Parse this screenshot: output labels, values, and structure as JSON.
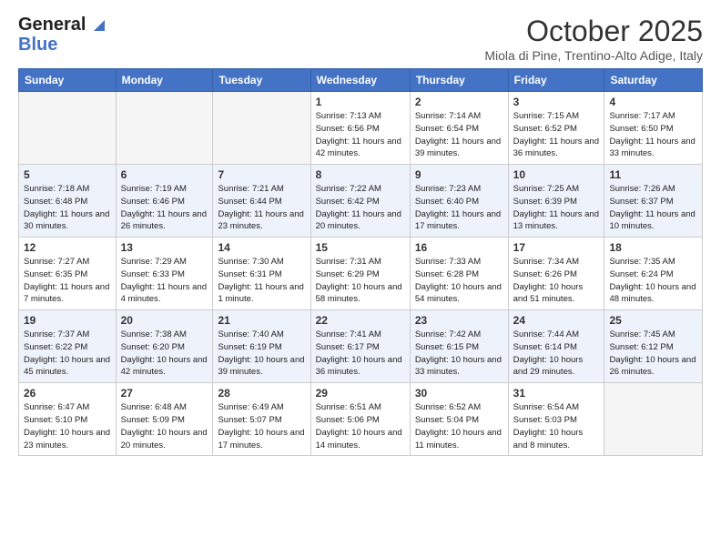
{
  "logo": {
    "line1": "General",
    "line2": "Blue"
  },
  "header": {
    "month": "October 2025",
    "location": "Miola di Pine, Trentino-Alto Adige, Italy"
  },
  "weekdays": [
    "Sunday",
    "Monday",
    "Tuesday",
    "Wednesday",
    "Thursday",
    "Friday",
    "Saturday"
  ],
  "weeks": [
    [
      {
        "day": "",
        "info": ""
      },
      {
        "day": "",
        "info": ""
      },
      {
        "day": "",
        "info": ""
      },
      {
        "day": "1",
        "info": "Sunrise: 7:13 AM\nSunset: 6:56 PM\nDaylight: 11 hours and 42 minutes."
      },
      {
        "day": "2",
        "info": "Sunrise: 7:14 AM\nSunset: 6:54 PM\nDaylight: 11 hours and 39 minutes."
      },
      {
        "day": "3",
        "info": "Sunrise: 7:15 AM\nSunset: 6:52 PM\nDaylight: 11 hours and 36 minutes."
      },
      {
        "day": "4",
        "info": "Sunrise: 7:17 AM\nSunset: 6:50 PM\nDaylight: 11 hours and 33 minutes."
      }
    ],
    [
      {
        "day": "5",
        "info": "Sunrise: 7:18 AM\nSunset: 6:48 PM\nDaylight: 11 hours and 30 minutes."
      },
      {
        "day": "6",
        "info": "Sunrise: 7:19 AM\nSunset: 6:46 PM\nDaylight: 11 hours and 26 minutes."
      },
      {
        "day": "7",
        "info": "Sunrise: 7:21 AM\nSunset: 6:44 PM\nDaylight: 11 hours and 23 minutes."
      },
      {
        "day": "8",
        "info": "Sunrise: 7:22 AM\nSunset: 6:42 PM\nDaylight: 11 hours and 20 minutes."
      },
      {
        "day": "9",
        "info": "Sunrise: 7:23 AM\nSunset: 6:40 PM\nDaylight: 11 hours and 17 minutes."
      },
      {
        "day": "10",
        "info": "Sunrise: 7:25 AM\nSunset: 6:39 PM\nDaylight: 11 hours and 13 minutes."
      },
      {
        "day": "11",
        "info": "Sunrise: 7:26 AM\nSunset: 6:37 PM\nDaylight: 11 hours and 10 minutes."
      }
    ],
    [
      {
        "day": "12",
        "info": "Sunrise: 7:27 AM\nSunset: 6:35 PM\nDaylight: 11 hours and 7 minutes."
      },
      {
        "day": "13",
        "info": "Sunrise: 7:29 AM\nSunset: 6:33 PM\nDaylight: 11 hours and 4 minutes."
      },
      {
        "day": "14",
        "info": "Sunrise: 7:30 AM\nSunset: 6:31 PM\nDaylight: 11 hours and 1 minute."
      },
      {
        "day": "15",
        "info": "Sunrise: 7:31 AM\nSunset: 6:29 PM\nDaylight: 10 hours and 58 minutes."
      },
      {
        "day": "16",
        "info": "Sunrise: 7:33 AM\nSunset: 6:28 PM\nDaylight: 10 hours and 54 minutes."
      },
      {
        "day": "17",
        "info": "Sunrise: 7:34 AM\nSunset: 6:26 PM\nDaylight: 10 hours and 51 minutes."
      },
      {
        "day": "18",
        "info": "Sunrise: 7:35 AM\nSunset: 6:24 PM\nDaylight: 10 hours and 48 minutes."
      }
    ],
    [
      {
        "day": "19",
        "info": "Sunrise: 7:37 AM\nSunset: 6:22 PM\nDaylight: 10 hours and 45 minutes."
      },
      {
        "day": "20",
        "info": "Sunrise: 7:38 AM\nSunset: 6:20 PM\nDaylight: 10 hours and 42 minutes."
      },
      {
        "day": "21",
        "info": "Sunrise: 7:40 AM\nSunset: 6:19 PM\nDaylight: 10 hours and 39 minutes."
      },
      {
        "day": "22",
        "info": "Sunrise: 7:41 AM\nSunset: 6:17 PM\nDaylight: 10 hours and 36 minutes."
      },
      {
        "day": "23",
        "info": "Sunrise: 7:42 AM\nSunset: 6:15 PM\nDaylight: 10 hours and 33 minutes."
      },
      {
        "day": "24",
        "info": "Sunrise: 7:44 AM\nSunset: 6:14 PM\nDaylight: 10 hours and 29 minutes."
      },
      {
        "day": "25",
        "info": "Sunrise: 7:45 AM\nSunset: 6:12 PM\nDaylight: 10 hours and 26 minutes."
      }
    ],
    [
      {
        "day": "26",
        "info": "Sunrise: 6:47 AM\nSunset: 5:10 PM\nDaylight: 10 hours and 23 minutes."
      },
      {
        "day": "27",
        "info": "Sunrise: 6:48 AM\nSunset: 5:09 PM\nDaylight: 10 hours and 20 minutes."
      },
      {
        "day": "28",
        "info": "Sunrise: 6:49 AM\nSunset: 5:07 PM\nDaylight: 10 hours and 17 minutes."
      },
      {
        "day": "29",
        "info": "Sunrise: 6:51 AM\nSunset: 5:06 PM\nDaylight: 10 hours and 14 minutes."
      },
      {
        "day": "30",
        "info": "Sunrise: 6:52 AM\nSunset: 5:04 PM\nDaylight: 10 hours and 11 minutes."
      },
      {
        "day": "31",
        "info": "Sunrise: 6:54 AM\nSunset: 5:03 PM\nDaylight: 10 hours and 8 minutes."
      },
      {
        "day": "",
        "info": ""
      }
    ]
  ]
}
